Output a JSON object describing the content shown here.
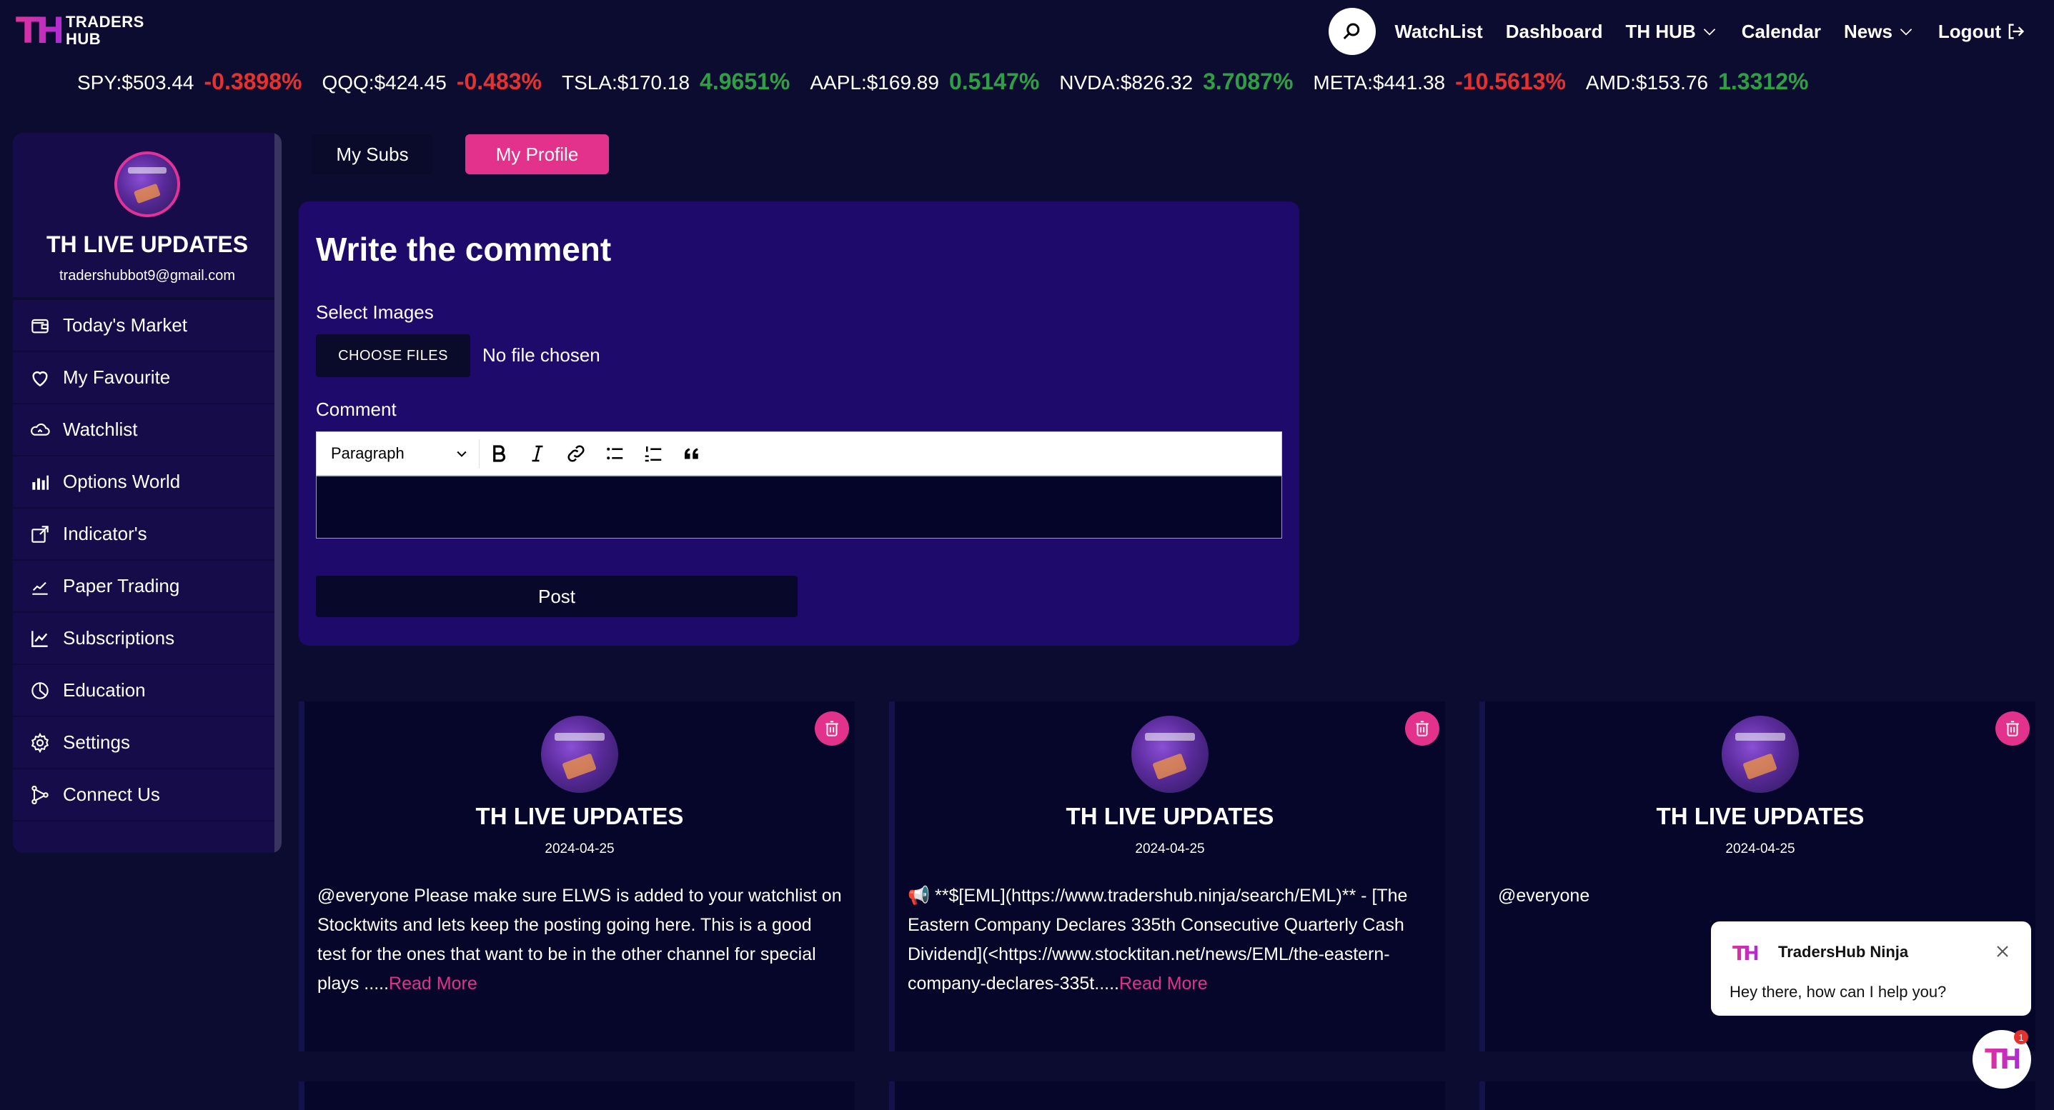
{
  "brand": {
    "mark": "TH",
    "name": "TRADERS HUB"
  },
  "nav": {
    "links": [
      "WatchList",
      "Dashboard",
      "TH HUB",
      "Calendar",
      "News",
      "Logout"
    ]
  },
  "ticker": [
    {
      "symbol": "SPY:$503.44",
      "change": "-0.3898%",
      "direction": "down"
    },
    {
      "symbol": "QQQ:$424.45",
      "change": "-0.483%",
      "direction": "down"
    },
    {
      "symbol": "TSLA:$170.18",
      "change": "4.9651%",
      "direction": "up"
    },
    {
      "symbol": "AAPL:$169.89",
      "change": "0.5147%",
      "direction": "up"
    },
    {
      "symbol": "NVDA:$826.32",
      "change": "3.7087%",
      "direction": "up"
    },
    {
      "symbol": "META:$441.38",
      "change": "-10.5613%",
      "direction": "down"
    },
    {
      "symbol": "AMD:$153.76",
      "change": "1.3312%",
      "direction": "up"
    }
  ],
  "sidebar": {
    "name": "TH LIVE UPDATES",
    "email": "tradershubbot9@gmail.com",
    "items": [
      {
        "label": "Today's Market",
        "icon": "wallet-icon"
      },
      {
        "label": "My Favourite",
        "icon": "heart-icon"
      },
      {
        "label": "Watchlist",
        "icon": "cloud-icon"
      },
      {
        "label": "Options World",
        "icon": "chart-bars-icon"
      },
      {
        "label": "Indicator's",
        "icon": "external-link-icon"
      },
      {
        "label": "Paper Trading",
        "icon": "line-chart-icon"
      },
      {
        "label": "Subscriptions",
        "icon": "area-chart-icon"
      },
      {
        "label": "Education",
        "icon": "pie-icon"
      },
      {
        "label": "Settings",
        "icon": "gear-icon"
      },
      {
        "label": "Connect Us",
        "icon": "network-icon"
      }
    ]
  },
  "tabs": {
    "subs": "My Subs",
    "profile": "My Profile"
  },
  "comment_form": {
    "heading": "Write the comment",
    "images_label": "Select Images",
    "choose_files": "CHOOSE FILES",
    "file_status": "No file chosen",
    "comment_label": "Comment",
    "paragraph_select": "Paragraph",
    "post_button": "Post"
  },
  "posts": [
    {
      "title": "TH LIVE UPDATES",
      "date": "2024-04-25",
      "body": "@everyone Please make sure ELWS is added to your watchlist on Stocktwits and lets keep the posting going here. This is a good test for the ones that want to be in the other channel for special plays .....",
      "read_more": "Read More"
    },
    {
      "title": "TH LIVE UPDATES",
      "date": "2024-04-25",
      "body": "📢 **$[EML](https://www.tradershub.ninja/search/EML)** - [The Eastern Company Declares 335th Consecutive Quarterly Cash Dividend](<https://www.stocktitan.net/news/EML/the-eastern-company-declares-335t.....",
      "read_more": "Read More"
    },
    {
      "title": "TH LIVE UPDATES",
      "date": "2024-04-25",
      "body": "@everyone",
      "read_more": ""
    }
  ],
  "chat": {
    "mark": "TH",
    "title": "TradersHub Ninja",
    "message": "Hey there, how can I help you?",
    "badge": "1"
  },
  "colors": {
    "accent": "#e2328b",
    "background": "#0c0b30",
    "card": "#1d0a6b",
    "negative": "#e5322f",
    "positive": "#2ea043"
  }
}
